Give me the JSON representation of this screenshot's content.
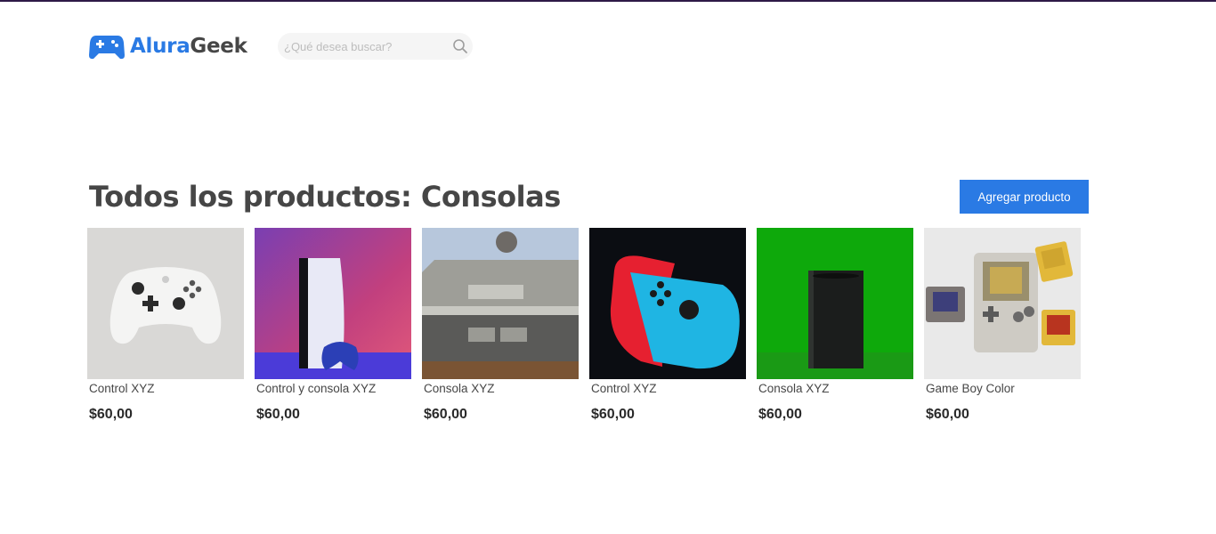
{
  "brand": {
    "part1": "Alura",
    "part2": "Geek",
    "logo_icon": "gamepad-icon",
    "accent_color": "#2a7ae4"
  },
  "search": {
    "placeholder": "¿Qué desea buscar?",
    "icon": "search-icon"
  },
  "page": {
    "title": "Todos los productos: Consolas",
    "add_button": "Agregar producto"
  },
  "products": [
    {
      "name": "Control XYZ",
      "price": "$60,00",
      "image": "white-xbox-controller"
    },
    {
      "name": "Control y consola XYZ",
      "price": "$60,00",
      "image": "ps5-console-and-controller"
    },
    {
      "name": "Consola XYZ",
      "price": "$60,00",
      "image": "nintendo-nes-console"
    },
    {
      "name": "Control XYZ",
      "price": "$60,00",
      "image": "nintendo-switch-joycons"
    },
    {
      "name": "Consola XYZ",
      "price": "$60,00",
      "image": "xbox-series-x-green"
    },
    {
      "name": "Game Boy Color",
      "price": "$60,00",
      "image": "game-boy-with-cartridges"
    }
  ]
}
